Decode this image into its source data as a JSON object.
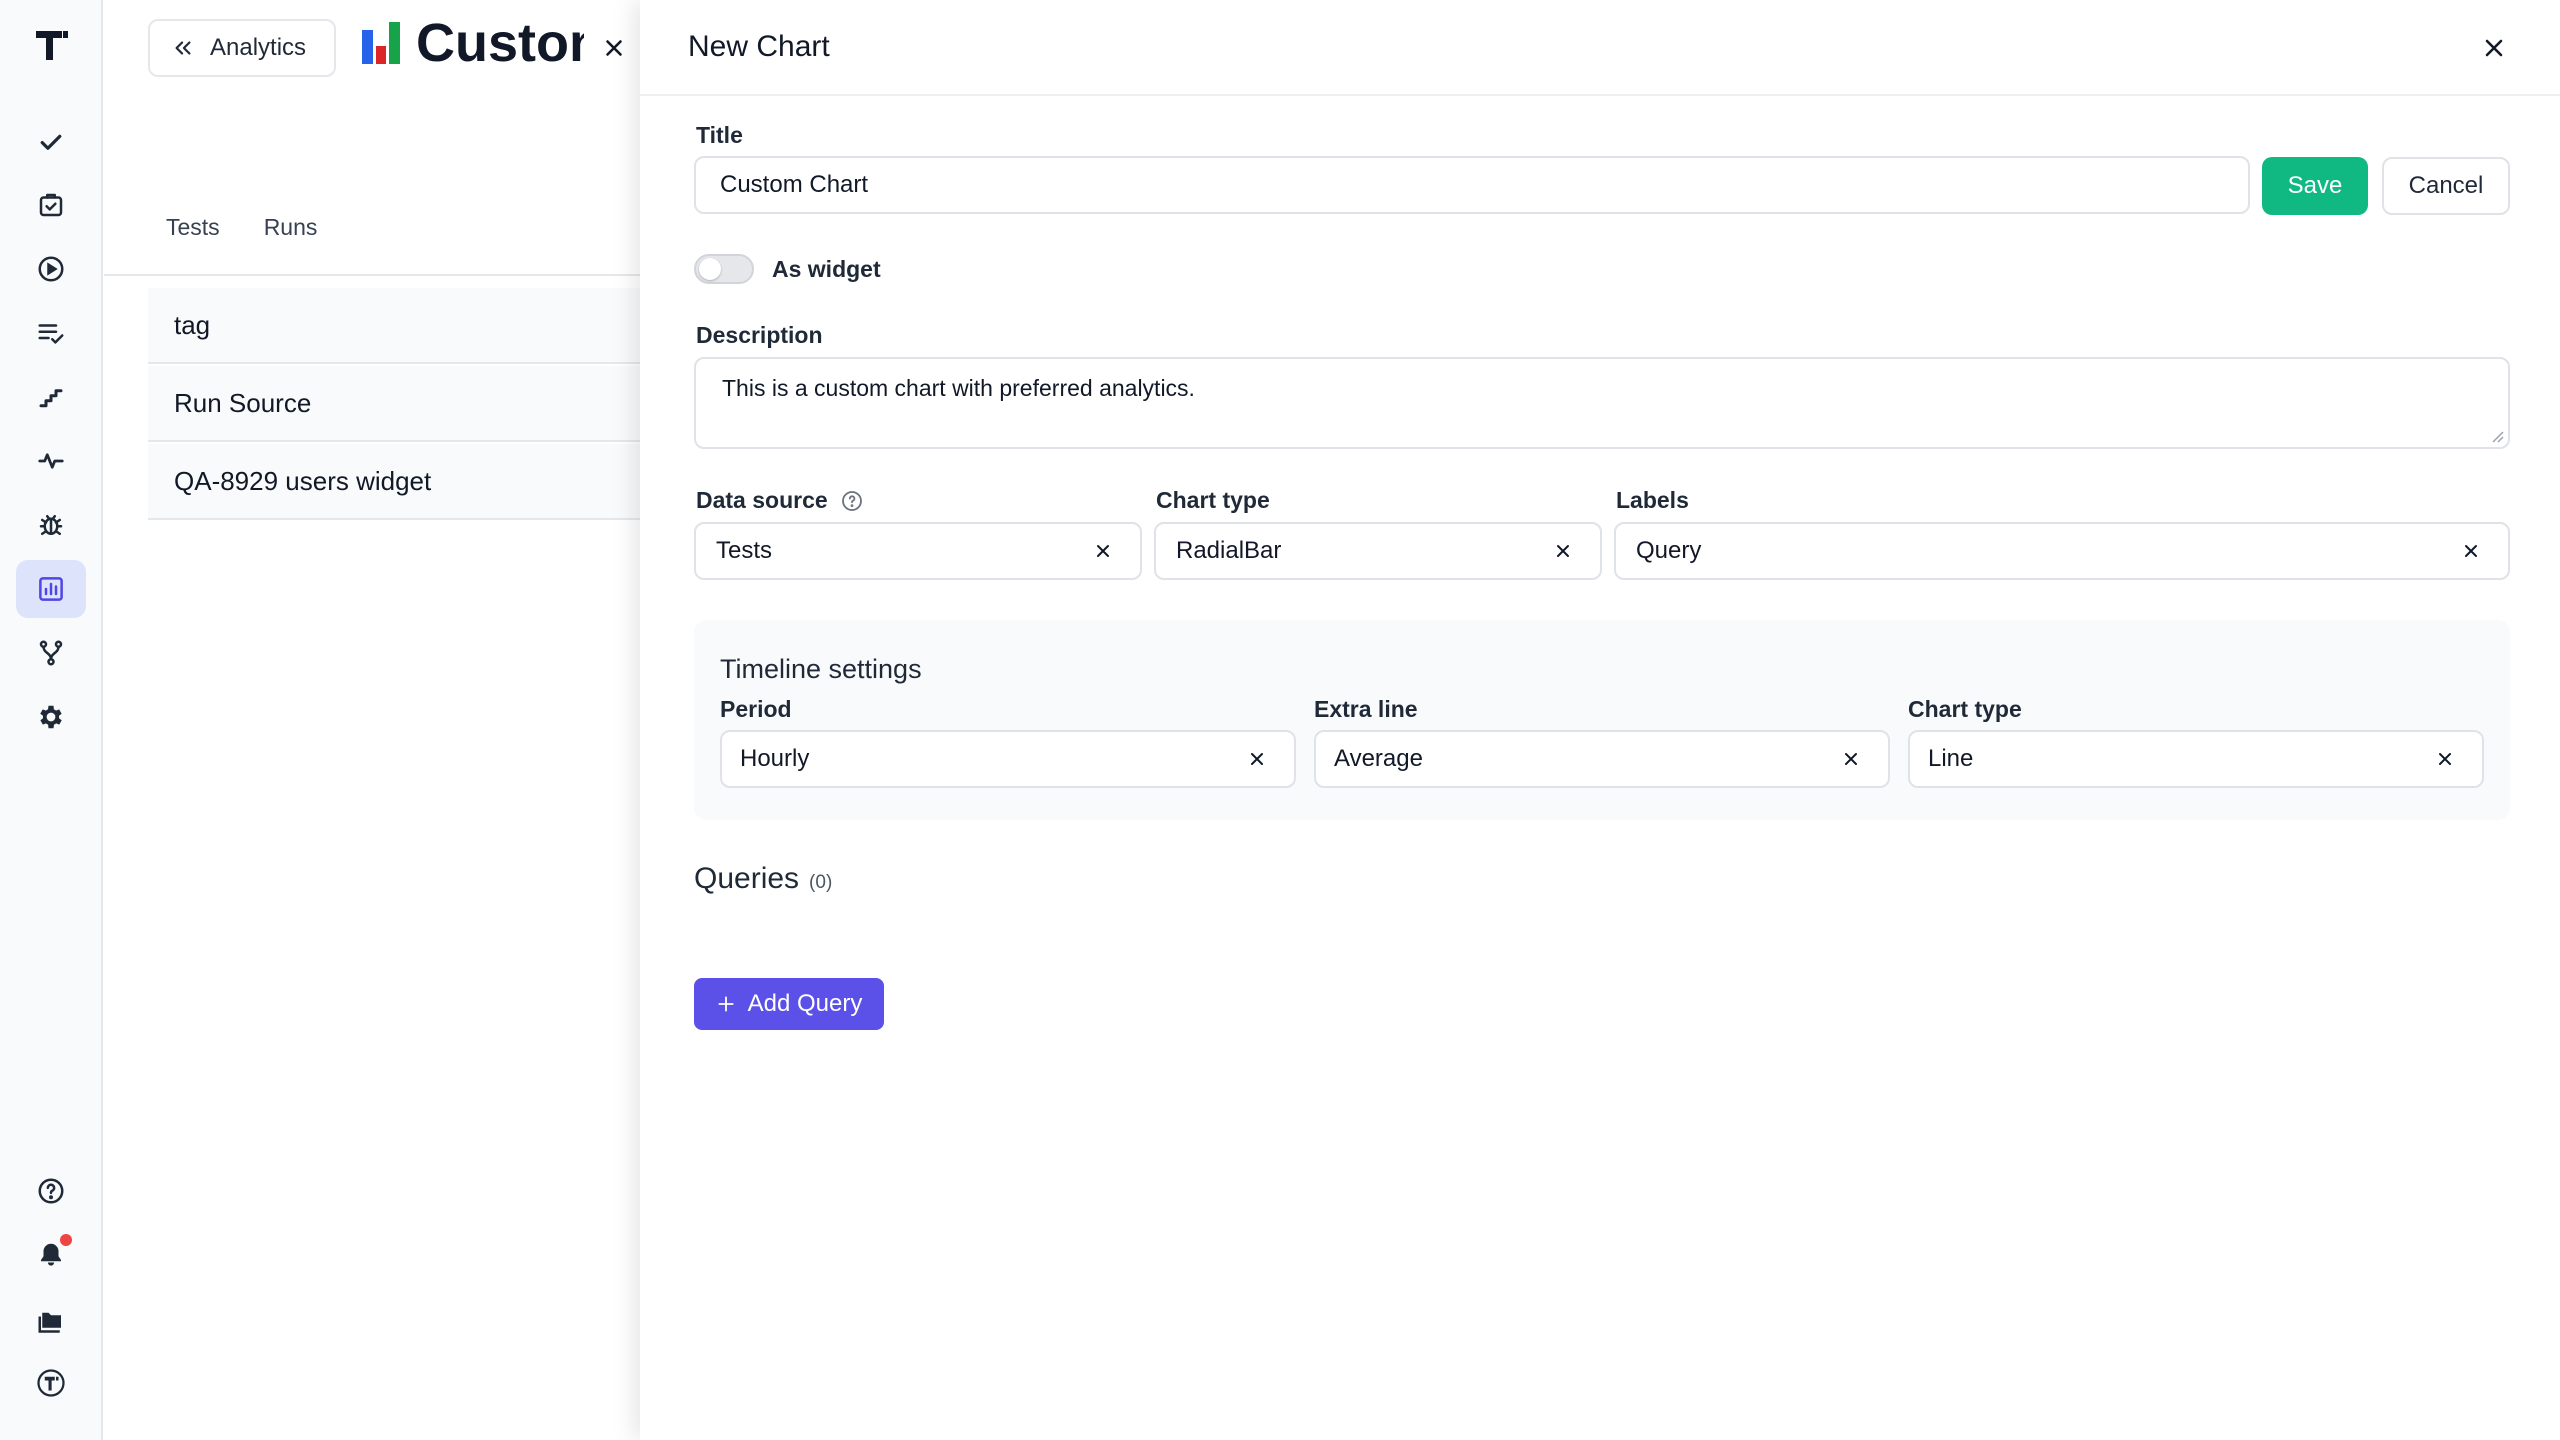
{
  "sidebar": {
    "items": [
      {
        "icon": "check-icon"
      },
      {
        "icon": "clipboard-check-icon"
      },
      {
        "icon": "play-circle-icon"
      },
      {
        "icon": "list-check-icon"
      },
      {
        "icon": "stairs-icon"
      },
      {
        "icon": "pulse-icon"
      },
      {
        "icon": "bug-icon"
      },
      {
        "icon": "chart-icon",
        "active": true
      },
      {
        "icon": "branch-icon"
      },
      {
        "icon": "gear-icon"
      }
    ],
    "bottom_items": [
      {
        "icon": "help-icon"
      },
      {
        "icon": "bell-icon",
        "has_notification": true
      },
      {
        "icon": "folders-icon"
      },
      {
        "icon": "user-logo-icon"
      }
    ]
  },
  "page": {
    "back_label": "Analytics",
    "title": "Custon",
    "tabs": [
      "Tests",
      "Runs"
    ],
    "rows": [
      "tag",
      "Run Source",
      "QA-8929 users widget"
    ]
  },
  "drawer": {
    "title": "New Chart",
    "title_field": {
      "label": "Title",
      "value": "Custom Chart"
    },
    "save_label": "Save",
    "cancel_label": "Cancel",
    "widget_toggle": {
      "label": "As widget",
      "on": false
    },
    "description": {
      "label": "Description",
      "value": "This is a custom chart with preferred analytics."
    },
    "data_source": {
      "label": "Data source",
      "value": "Tests"
    },
    "chart_type": {
      "label": "Chart type",
      "value": "RadialBar"
    },
    "labels": {
      "label": "Labels",
      "value": "Query"
    },
    "timeline": {
      "title": "Timeline settings",
      "period": {
        "label": "Period",
        "value": "Hourly"
      },
      "extra_line": {
        "label": "Extra line",
        "value": "Average"
      },
      "chart_type": {
        "label": "Chart type",
        "value": "Line"
      }
    },
    "queries": {
      "title": "Queries",
      "count": "(0)"
    },
    "add_query_label": "Add Query"
  },
  "colors": {
    "accent": "#5b50e8",
    "save": "#10b981",
    "active_nav_bg": "#dde3fb",
    "notification": "#ef4444"
  }
}
